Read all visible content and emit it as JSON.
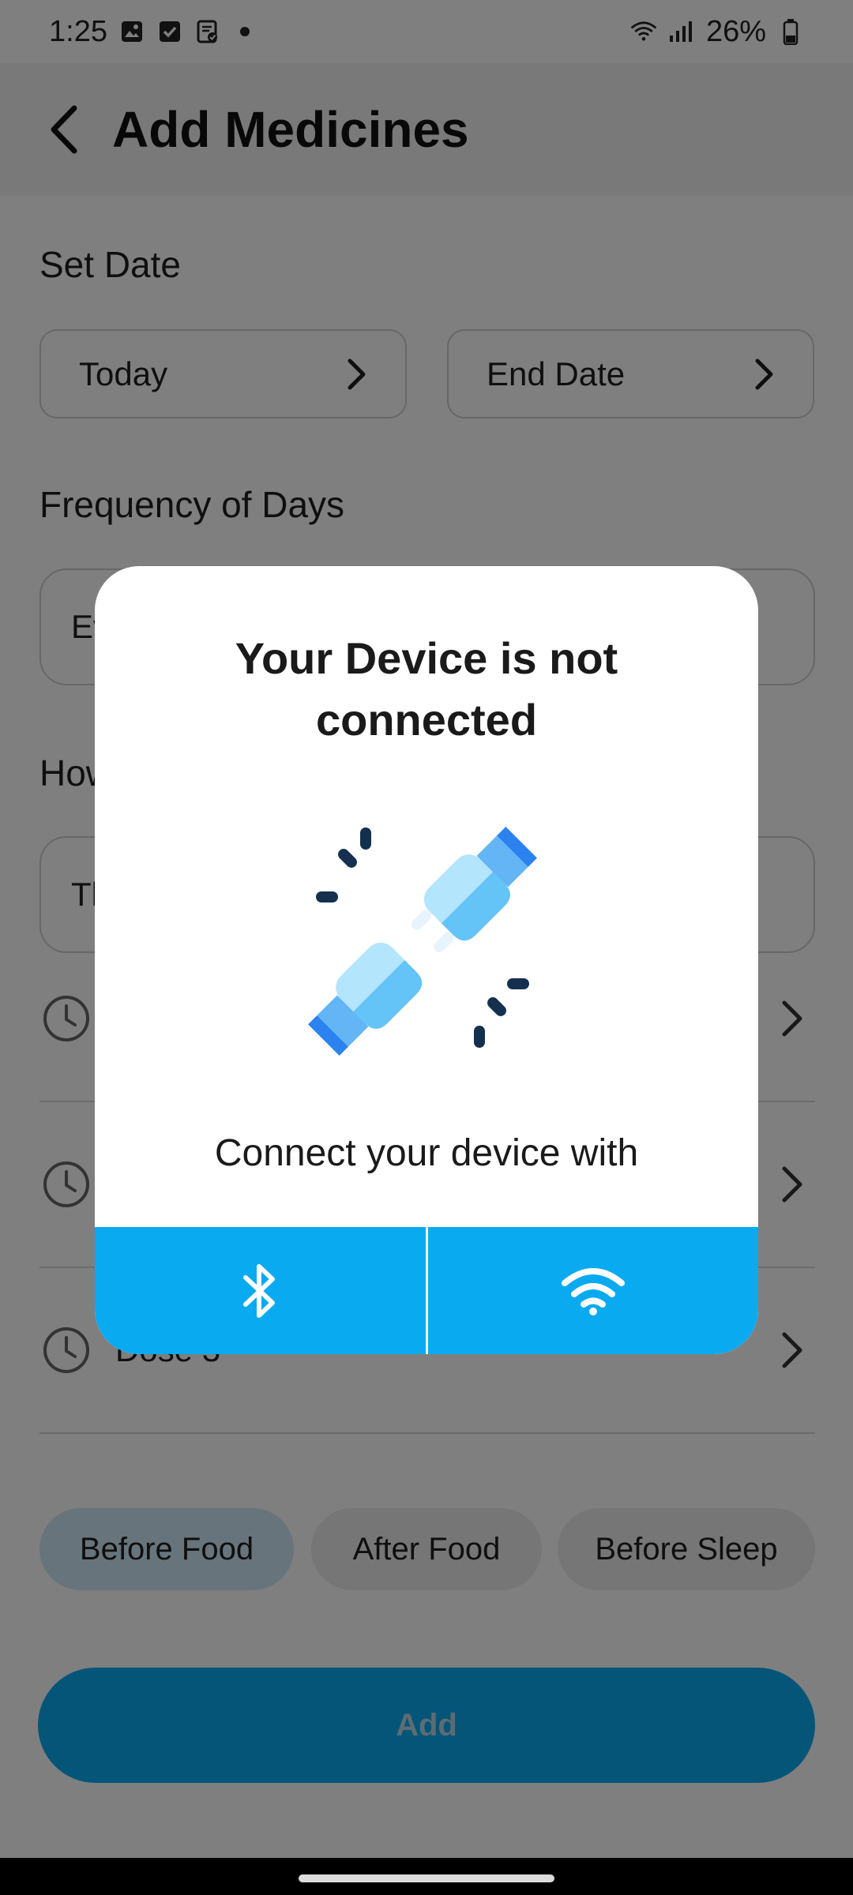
{
  "status_bar": {
    "time": "1:25",
    "battery": "26%"
  },
  "header": {
    "title": "Add Medicines"
  },
  "set_date": {
    "label": "Set Date",
    "start": "Today",
    "end": "End Date"
  },
  "frequency": {
    "label": "Frequency of Days",
    "value": "Ev"
  },
  "how_often": {
    "label": "How",
    "value": "Th"
  },
  "doses": [
    {
      "label": ""
    },
    {
      "label": ""
    },
    {
      "label": "Dose 3"
    }
  ],
  "meal_chips": [
    {
      "label": "Before Food",
      "selected": true
    },
    {
      "label": "After Food",
      "selected": false
    },
    {
      "label": "Before Sleep",
      "selected": false
    }
  ],
  "add_button": {
    "label": "Add"
  },
  "modal": {
    "title": "Your Device is not connected",
    "subtitle": "Connect your device with",
    "actions": [
      {
        "icon": "bluetooth-icon"
      },
      {
        "icon": "wifi-icon"
      }
    ]
  },
  "colors": {
    "accent": "#0AAAF0",
    "scrim": "rgba(0,0,0,0.5)"
  }
}
